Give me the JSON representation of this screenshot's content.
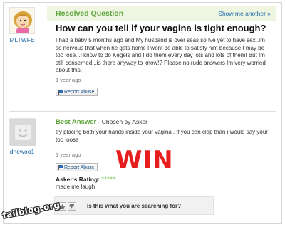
{
  "question": {
    "status": "Resolved Question",
    "show_more": "Show me another »",
    "username": "MLTWFE",
    "title": "How can you tell if your vagina is tight enough?",
    "body": "I had a baby 5 months ago and My husband is over seas so Ive yet to have sex..Im so nervous that when he gets home I wont be able to satisfy him because I may be too lose...I know to do Kegels and I do them every day lots and lots of them! But Im still conserned...is there anyway to know!? Please no rude answers Im very worried about this.",
    "time": "1 year ago",
    "report_label": "Report Abuse"
  },
  "answer": {
    "label": "Best Answer",
    "chosen_by": " - Chosen by Asker",
    "username": "dnewoo1",
    "body": "try placing both your hands inside your vagina . if you can clap than i would say your too loose",
    "time": "1 year ago",
    "report_label": "Report Abuse",
    "rating_label": "Asker's Rating:",
    "rating_stars": "*****",
    "rating_value": 5,
    "rating_max": 5,
    "rating_comment": "made me laugh"
  },
  "overlay": {
    "win_text": "WIN"
  },
  "search_bar": {
    "thumb_up_icon": "thumbs-up-icon",
    "thumb_down_icon": "thumbs-down-icon",
    "prompt": "Is this what you are searching for?"
  },
  "watermark": {
    "text": "failblog.org"
  },
  "colors": {
    "accent_green": "#5ba43a",
    "link_blue": "#1d6aa8",
    "win_red": "#e61e1e",
    "header_bg": "#eef5e1"
  }
}
